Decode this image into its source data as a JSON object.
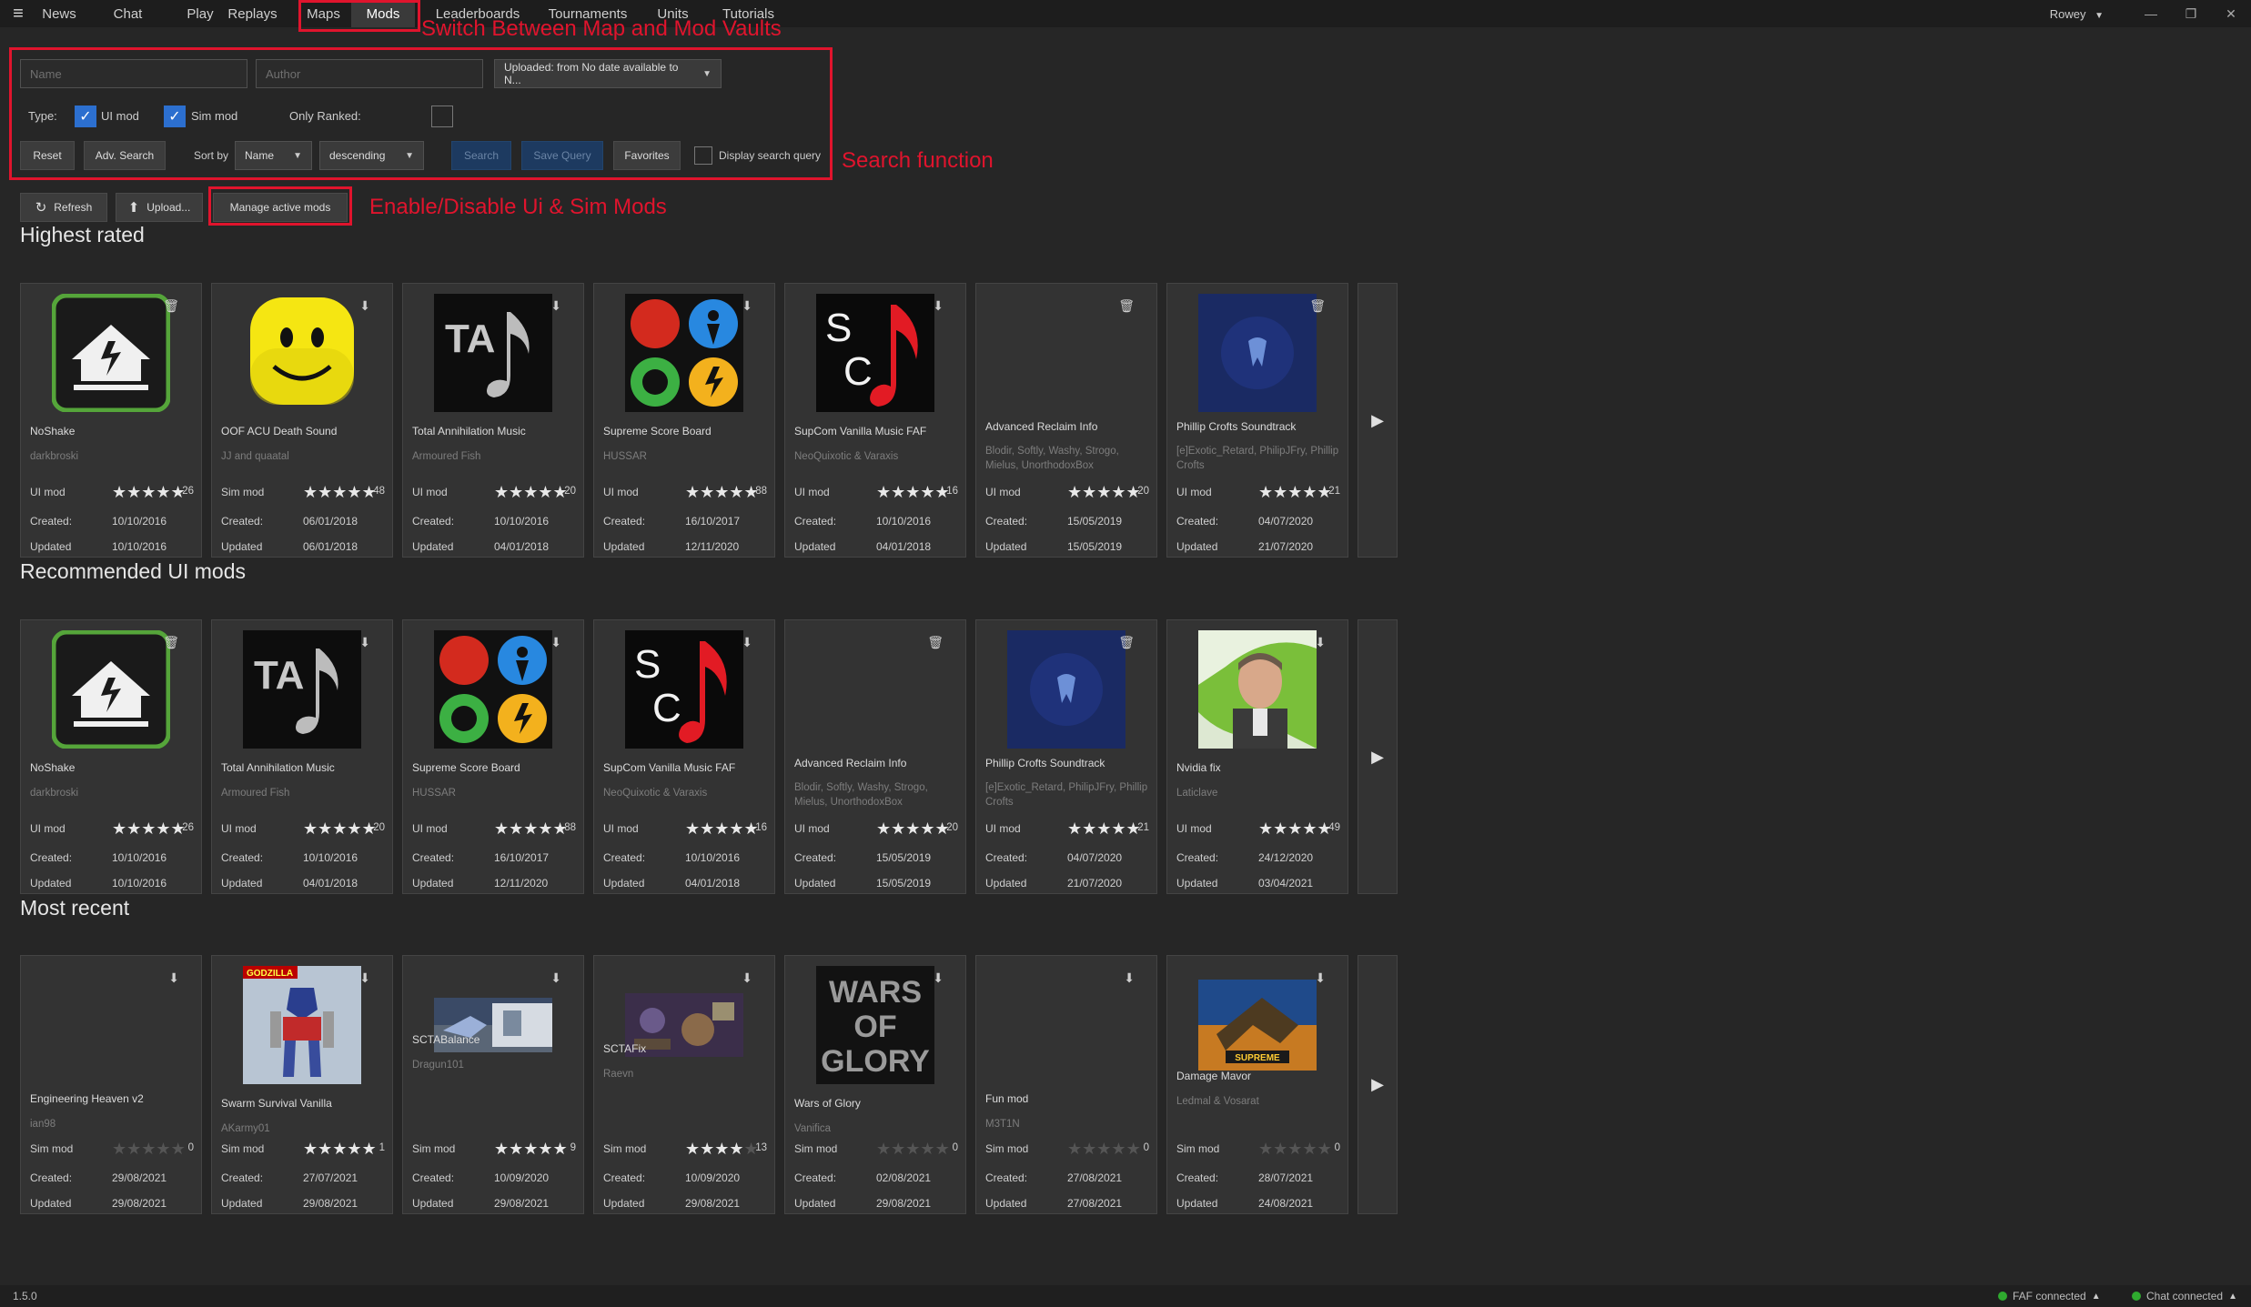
{
  "nav": {
    "items": [
      {
        "label": "News"
      },
      {
        "label": "Chat"
      },
      {
        "label": "Play"
      },
      {
        "label": "Replays"
      },
      {
        "label": "Maps"
      },
      {
        "label": "Mods"
      },
      {
        "label": "Leaderboards"
      },
      {
        "label": "Tournaments"
      },
      {
        "label": "Units"
      },
      {
        "label": "Tutorials"
      }
    ],
    "active": "Mods",
    "user": "Rowey"
  },
  "annotations": {
    "switch_vaults": "Switch Between Map and Mod Vaults",
    "search_function": "Search function",
    "enable_disable": "Enable/Disable Ui & Sim Mods",
    "color": "#e0142d"
  },
  "search": {
    "name_placeholder": "Name",
    "author_placeholder": "Author",
    "uploaded": "Uploaded: from No date available to N...",
    "type_label": "Type:",
    "ui_mod": "UI mod",
    "sim_mod": "Sim mod",
    "only_ranked": "Only Ranked:",
    "reset": "Reset",
    "adv_search": "Adv. Search",
    "sort_by": "Sort by",
    "sort_field": "Name",
    "sort_order": "descending",
    "search_btn": "Search",
    "save_query": "Save Query",
    "favorites": "Favorites",
    "display_query": "Display search query"
  },
  "toolbar": {
    "refresh": "Refresh",
    "upload": "Upload...",
    "manage": "Manage active mods"
  },
  "sections": [
    {
      "title": "Highest rated",
      "cards": [
        {
          "name": "NoShake",
          "author": "darkbroski",
          "type": "UI mod",
          "stars": 5,
          "count": "26",
          "created": "10/10/2016",
          "updated": "10/10/2016",
          "thumb": "noshake",
          "action": "trash-icon"
        },
        {
          "name": "OOF ACU Death Sound",
          "author": "JJ and quaatal",
          "type": "Sim mod",
          "stars": 4.5,
          "count": "48",
          "created": "06/01/2018",
          "updated": "06/01/2018",
          "thumb": "oof",
          "action": "download-icon"
        },
        {
          "name": "Total Annihilation Music",
          "author": "Armoured Fish",
          "type": "UI mod",
          "stars": 5,
          "count": "20",
          "created": "10/10/2016",
          "updated": "04/01/2018",
          "thumb": "ta",
          "action": "download-icon"
        },
        {
          "name": "Supreme Score Board",
          "author": "HUSSAR",
          "type": "UI mod",
          "stars": 4.5,
          "count": "88",
          "created": "16/10/2017",
          "updated": "12/11/2020",
          "thumb": "ssb",
          "action": "download-icon"
        },
        {
          "name": "SupCom Vanilla Music FAF",
          "author": "NeoQuixotic & Varaxis",
          "type": "UI mod",
          "stars": 5,
          "count": "16",
          "created": "10/10/2016",
          "updated": "04/01/2018",
          "thumb": "sc",
          "action": "download-icon"
        },
        {
          "name": "Advanced Reclaim Info",
          "author": "Blodir, Softly, Washy, Strogo, Mielus, UnorthodoxBox",
          "type": "UI mod",
          "stars": 5,
          "count": "20",
          "created": "15/05/2019",
          "updated": "15/05/2019",
          "thumb": "none",
          "action": "trash-icon"
        },
        {
          "name": "Phillip Crofts Soundtrack",
          "author": "[e]Exotic_Retard, PhilipJFry, Phillip Crofts",
          "type": "UI mod",
          "stars": 5,
          "count": "21",
          "created": "04/07/2020",
          "updated": "21/07/2020",
          "thumb": "phillip",
          "action": "trash-icon"
        }
      ]
    },
    {
      "title": "Recommended UI mods",
      "cards": [
        {
          "name": "NoShake",
          "author": "darkbroski",
          "type": "UI mod",
          "stars": 5,
          "count": "26",
          "created": "10/10/2016",
          "updated": "10/10/2016",
          "thumb": "noshake",
          "action": "trash-icon"
        },
        {
          "name": "Total Annihilation Music",
          "author": "Armoured Fish",
          "type": "UI mod",
          "stars": 5,
          "count": "20",
          "created": "10/10/2016",
          "updated": "04/01/2018",
          "thumb": "ta",
          "action": "download-icon"
        },
        {
          "name": "Supreme Score Board",
          "author": "HUSSAR",
          "type": "UI mod",
          "stars": 4.5,
          "count": "88",
          "created": "16/10/2017",
          "updated": "12/11/2020",
          "thumb": "ssb",
          "action": "download-icon"
        },
        {
          "name": "SupCom Vanilla Music FAF",
          "author": "NeoQuixotic & Varaxis",
          "type": "UI mod",
          "stars": 5,
          "count": "16",
          "created": "10/10/2016",
          "updated": "04/01/2018",
          "thumb": "sc",
          "action": "download-icon"
        },
        {
          "name": "Advanced Reclaim Info",
          "author": "Blodir, Softly, Washy, Strogo, Mielus, UnorthodoxBox",
          "type": "UI mod",
          "stars": 5,
          "count": "20",
          "created": "15/05/2019",
          "updated": "15/05/2019",
          "thumb": "none",
          "action": "trash-icon"
        },
        {
          "name": "Phillip Crofts Soundtrack",
          "author": "[e]Exotic_Retard, PhilipJFry, Phillip Crofts",
          "type": "UI mod",
          "stars": 5,
          "count": "21",
          "created": "04/07/2020",
          "updated": "21/07/2020",
          "thumb": "phillip",
          "action": "trash-icon"
        },
        {
          "name": "Nvidia fix",
          "author": "Laticlave",
          "type": "UI mod",
          "stars": 4.5,
          "count": "49",
          "created": "24/12/2020",
          "updated": "03/04/2021",
          "thumb": "nvidia",
          "action": "download-icon"
        }
      ]
    },
    {
      "title": "Most recent",
      "cards": [
        {
          "name": "Engineering Heaven v2",
          "author": "ian98",
          "type": "Sim mod",
          "stars": 0,
          "count": "0",
          "created": "29/08/2021",
          "updated": "29/08/2021",
          "thumb": "none",
          "action": "download-icon"
        },
        {
          "name": "Swarm Survival Vanilla",
          "author": "AKarmy01",
          "type": "Sim mod",
          "stars": 5,
          "count": "1",
          "created": "27/07/2021",
          "updated": "29/08/2021",
          "thumb": "swarm",
          "action": "download-icon"
        },
        {
          "name": "SCTABalance",
          "author": "Dragun101",
          "type": "Sim mod",
          "stars": 5,
          "count": "9",
          "created": "10/09/2020",
          "updated": "29/08/2021",
          "thumb": "scta",
          "action": "download-icon"
        },
        {
          "name": "SCTAFix",
          "author": "Raevn",
          "type": "Sim mod",
          "stars": 4,
          "count": "13",
          "created": "10/09/2020",
          "updated": "29/08/2021",
          "thumb": "sctafix",
          "action": "download-icon"
        },
        {
          "name": "Wars of Glory",
          "author": "Vanifica",
          "type": "Sim mod",
          "stars": 0,
          "count": "0",
          "created": "02/08/2021",
          "updated": "29/08/2021",
          "thumb": "wars",
          "action": "download-icon"
        },
        {
          "name": "Fun mod",
          "author": "M3T1N",
          "type": "Sim mod",
          "stars": 0,
          "count": "0",
          "created": "27/08/2021",
          "updated": "27/08/2021",
          "thumb": "none",
          "action": "download-icon"
        },
        {
          "name": "Damage Mavor",
          "author": "Ledmal & Vosarat",
          "type": "Sim mod",
          "stars": 0,
          "count": "0",
          "created": "28/07/2021",
          "updated": "24/08/2021",
          "thumb": "damage",
          "action": "download-icon"
        }
      ]
    }
  ],
  "labels": {
    "created": "Created:",
    "updated": "Updated"
  },
  "status": {
    "version": "1.5.0",
    "faf": "FAF connected",
    "chat": "Chat connected"
  },
  "thumb_text": {
    "ta": "TA",
    "wars": "WARS OF GLORY",
    "supreme": "SUPREME"
  }
}
